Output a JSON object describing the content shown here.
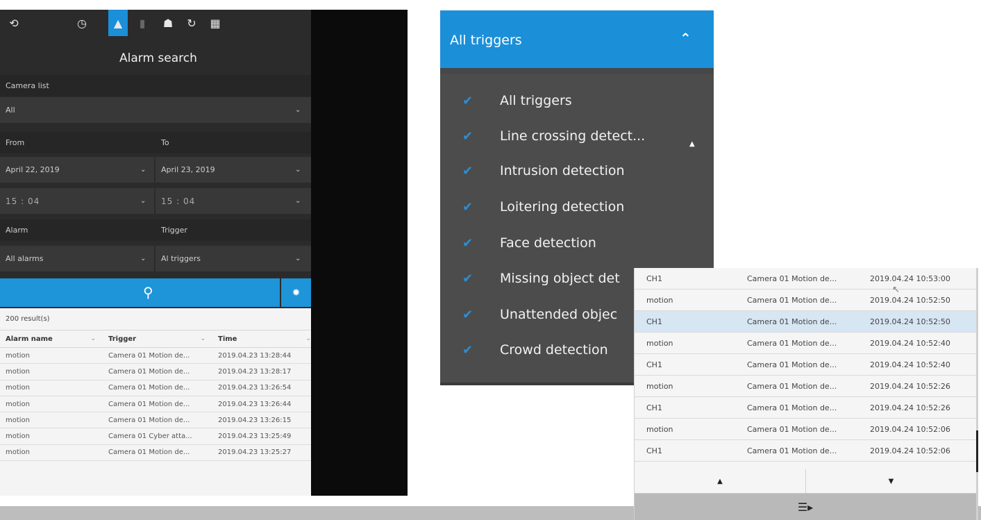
{
  "left_panel": {
    "toolbar_icons": [
      "back-icon",
      "clock-icon",
      "bell-icon",
      "user-icon",
      "face-icon",
      "refresh-icon",
      "grid-icon"
    ],
    "toolbar_glyphs": [
      "⟲",
      "◷",
      "▲",
      "▮",
      "☗",
      "↻",
      "▦"
    ],
    "title": "Alarm search",
    "camera_list_label": "Camera list",
    "camera_list_value": "All",
    "from_label": "From",
    "to_label": "To",
    "from_date": "April 22, 2019",
    "to_date": "April 23, 2019",
    "from_time": "15 : 04",
    "to_time": "15 : 04",
    "alarm_label": "Alarm",
    "trigger_label": "Trigger",
    "alarm_value": "All alarms",
    "trigger_value": "Al triggers",
    "search_glyph": "⚲",
    "gear_glyph": "✹",
    "results_count": "200 result(s)",
    "columns": [
      "Alarm name",
      "Trigger",
      "Time"
    ],
    "rows": [
      [
        "motion",
        "Camera 01 Motion de...",
        "2019.04.23 13:28:44"
      ],
      [
        "motion",
        "Camera 01 Motion de...",
        "2019.04.23 13:28:17"
      ],
      [
        "motion",
        "Camera 01 Motion de...",
        "2019.04.23 13:26:54"
      ],
      [
        "motion",
        "Camera 01 Motion de...",
        "2019.04.23 13:26:44"
      ],
      [
        "motion",
        "Camera 01 Motion de...",
        "2019.04.23 13:26:15"
      ],
      [
        "motion",
        "Camera 01 Cyber atta...",
        "2019.04.23 13:25:49"
      ],
      [
        "motion",
        "Camera 01 Motion de...",
        "2019.04.23 13:25:27"
      ]
    ]
  },
  "trigger_panel": {
    "header": "All triggers",
    "items": [
      "All triggers",
      "Line crossing detect...",
      "Intrusion detection",
      "Loitering detection",
      "Face detection",
      "Missing object det",
      "Unattended objec",
      "Crowd detection"
    ],
    "check_glyph": "✔"
  },
  "popup": {
    "rows": [
      [
        "CH1",
        "Camera 01 Motion de...",
        "2019.04.24 10:53:00"
      ],
      [
        "motion",
        "Camera 01 Motion de...",
        "2019.04.24 10:52:50"
      ],
      [
        "CH1",
        "Camera 01 Motion de...",
        "2019.04.24 10:52:50"
      ],
      [
        "motion",
        "Camera 01 Motion de...",
        "2019.04.24 10:52:40"
      ],
      [
        "CH1",
        "Camera 01 Motion de...",
        "2019.04.24 10:52:40"
      ],
      [
        "motion",
        "Camera 01 Motion de...",
        "2019.04.24 10:52:26"
      ],
      [
        "CH1",
        "Camera 01 Motion de...",
        "2019.04.24 10:52:26"
      ],
      [
        "motion",
        "Camera 01 Motion de...",
        "2019.04.24 10:52:06"
      ],
      [
        "CH1",
        "Camera 01 Motion de...",
        "2019.04.24 10:52:06"
      ]
    ],
    "selected_row": 2,
    "prev_glyph": "▲",
    "next_glyph": "▼",
    "list_glyph": "☰▸"
  },
  "colors": {
    "accent": "#1b8fd8",
    "panel_dark": "#2b2b2b",
    "trigger_bg": "#4c4c4c"
  }
}
